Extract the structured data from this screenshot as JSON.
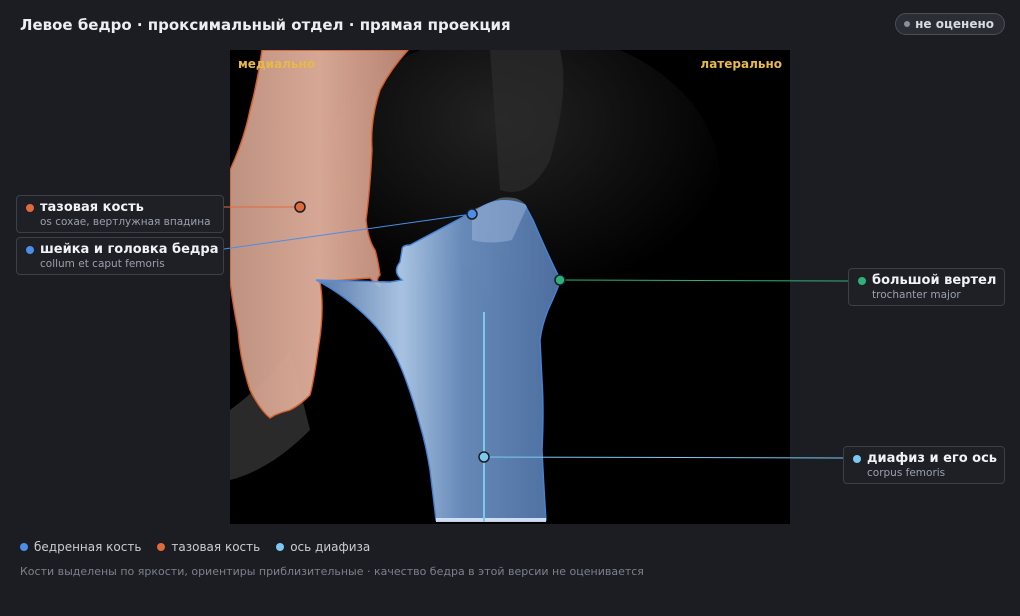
{
  "header": {
    "title": "Левое бедро · проксимальный отдел · прямая проекция",
    "status_badge": "не оценено"
  },
  "viewer": {
    "orientation_left": "медиально",
    "orientation_right": "латерально"
  },
  "annotations": [
    {
      "name": "тазовая кость",
      "latin": "os coxae, вертлужная впадина",
      "color": "#e06a3c"
    },
    {
      "name": "шейка и головка бедра",
      "latin": "collum et caput femoris",
      "color": "#4a8ee8"
    },
    {
      "name": "большой вертел",
      "latin": "trochanter major",
      "color": "#2eb07a"
    },
    {
      "name": "диафиз и его ось",
      "latin": "corpus femoris",
      "color": "#7cc8f0"
    }
  ],
  "legend": [
    {
      "label": "бедренная кость",
      "color": "#4a8ee8"
    },
    {
      "label": "тазовая кость",
      "color": "#e06a3c"
    },
    {
      "label": "ось диафиза",
      "color": "#7cc8f0"
    }
  ],
  "footnote": "Кости выделены по яркости, ориентиры приблизительные · качество бедра в этой версии не оценивается"
}
